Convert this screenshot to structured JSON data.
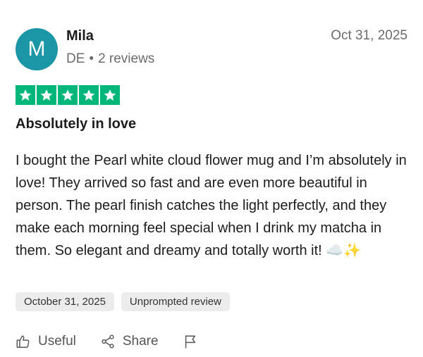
{
  "reviewer": {
    "initial": "M",
    "name": "Mila",
    "country": "DE",
    "separator": "•",
    "review_count": "2 reviews"
  },
  "review": {
    "date": "Oct 31, 2025",
    "rating": 5,
    "title": "Absolutely in love",
    "body": "I bought the Pearl white cloud flower mug and I’m absolutely in love! They arrived so fast and are even more beautiful in person. The pearl finish catches the light perfectly, and they make each morning feel special when I drink my matcha in them. So elegant and dreamy and totally worth it! ☁️✨"
  },
  "tags": {
    "experience_date": "October 31, 2025",
    "type": "Unprompted review"
  },
  "actions": {
    "useful_label": "Useful",
    "share_label": "Share"
  },
  "colors": {
    "avatar": "#1a96a6",
    "star": "#00b67a"
  },
  "icons": [
    "thumbs-up-icon",
    "share-icon",
    "flag-icon",
    "star-icon"
  ]
}
